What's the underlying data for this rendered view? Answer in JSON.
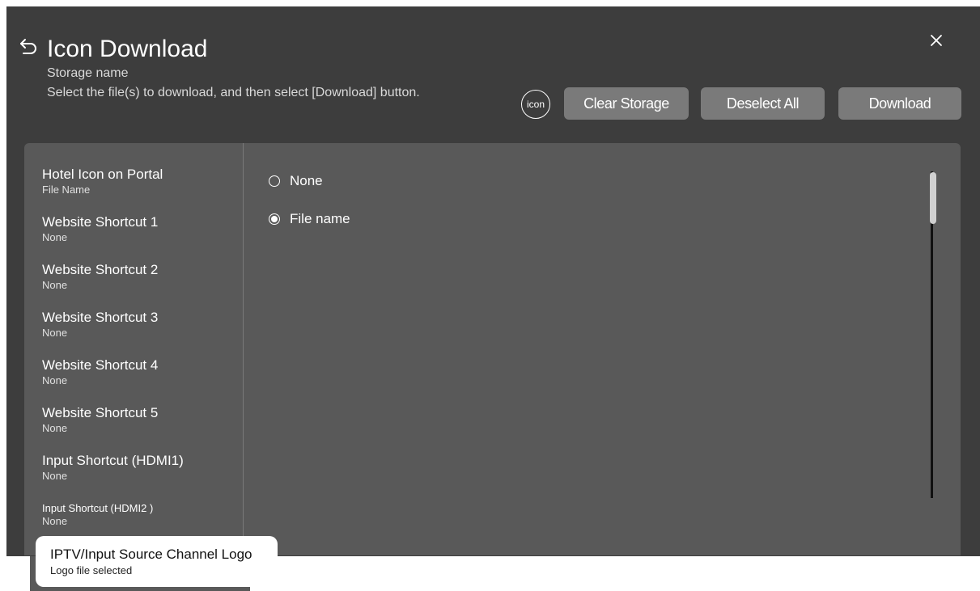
{
  "header": {
    "title": "Icon Download",
    "subtitle": "Storage name",
    "instruction": "Select the file(s) to download, and then select [Download] button.",
    "icon_badge": "icon",
    "buttons": {
      "clear_storage": "Clear Storage",
      "deselect_all": "Deselect All",
      "download": "Download"
    }
  },
  "sidebar": {
    "items": [
      {
        "label": "Hotel Icon on Portal",
        "value": "File Name"
      },
      {
        "label": "Website Shortcut 1",
        "value": "None"
      },
      {
        "label": "Website Shortcut 2",
        "value": "None"
      },
      {
        "label": "Website Shortcut 3",
        "value": "None"
      },
      {
        "label": "Website Shortcut 4",
        "value": "None"
      },
      {
        "label": "Website Shortcut 5",
        "value": "None"
      },
      {
        "label": "Input Shortcut (HDMI1)",
        "value": "None"
      },
      {
        "label": "Input Shortcut (HDMI2 )",
        "value": "None"
      }
    ],
    "focused_item": {
      "label": "IPTV/Input Source Channel Logo",
      "value": "Logo file selected"
    }
  },
  "options": {
    "items": [
      {
        "label": "None",
        "selected": false
      },
      {
        "label": "File name",
        "selected": true
      }
    ]
  },
  "colors": {
    "background": "#3d3d3d",
    "panel": "#595959",
    "button": "#7a7a7a",
    "focus": "#ffffff"
  },
  "icons": {
    "back": "back-arrow-icon",
    "close": "close-icon"
  }
}
